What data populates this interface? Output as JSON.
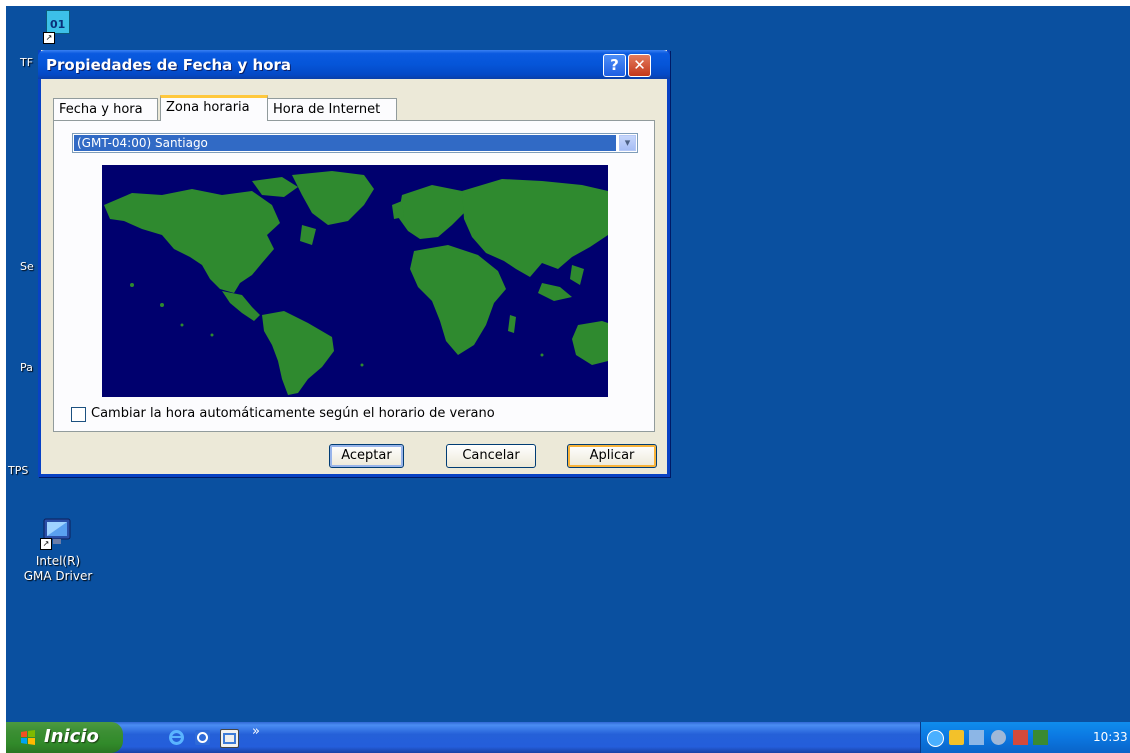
{
  "desktop": {
    "icons": [
      {
        "label": "Intel(R) GMA Driver"
      }
    ],
    "top_icon_text": "01",
    "edge_labels": [
      "TF",
      "Se",
      "Pa",
      "TPS"
    ]
  },
  "dialog": {
    "title": "Propiedades de Fecha y hora",
    "help_glyph": "?",
    "close_glyph": "✕",
    "tabs": [
      {
        "label": "Fecha y hora",
        "active": false
      },
      {
        "label": "Zona horaria",
        "active": true
      },
      {
        "label": "Hora de Internet",
        "active": false
      }
    ],
    "timezone": {
      "selected": "(GMT-04:00) Santiago"
    },
    "map": {
      "ocean_color": "#00006e",
      "land_color": "#2f8a2f"
    },
    "checkbox": {
      "label": "Cambiar la hora automáticamente según el horario de verano",
      "checked": false
    },
    "buttons": {
      "ok": "Aceptar",
      "cancel": "Cancelar",
      "apply": "Aplicar"
    }
  },
  "taskbar": {
    "start_label": "Inicio",
    "quick_launch_more": "»",
    "clock": "10:33"
  },
  "colors": {
    "desktop": "#0a50a0",
    "titlebar": "#0555d8",
    "dialog_face": "#ece9d8",
    "selection": "#316ac5"
  }
}
